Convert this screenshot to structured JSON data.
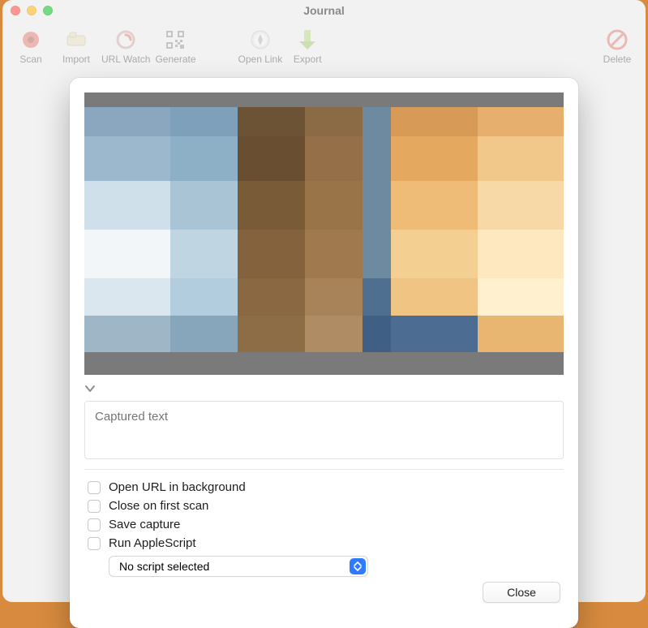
{
  "window": {
    "title": "Journal"
  },
  "toolbar": {
    "items": [
      {
        "label": "Scan"
      },
      {
        "label": "Import"
      },
      {
        "label": "URL Watch"
      },
      {
        "label": "Generate"
      },
      {
        "label": "Open Link"
      },
      {
        "label": "Export"
      },
      {
        "label": "Delete"
      }
    ]
  },
  "sheet": {
    "captured_placeholder": "Captured text",
    "options": [
      {
        "label": "Open URL in background"
      },
      {
        "label": "Close on first scan"
      },
      {
        "label": "Save capture"
      },
      {
        "label": "Run AppleScript"
      }
    ],
    "script_select": "No script selected",
    "close_label": "Close"
  }
}
